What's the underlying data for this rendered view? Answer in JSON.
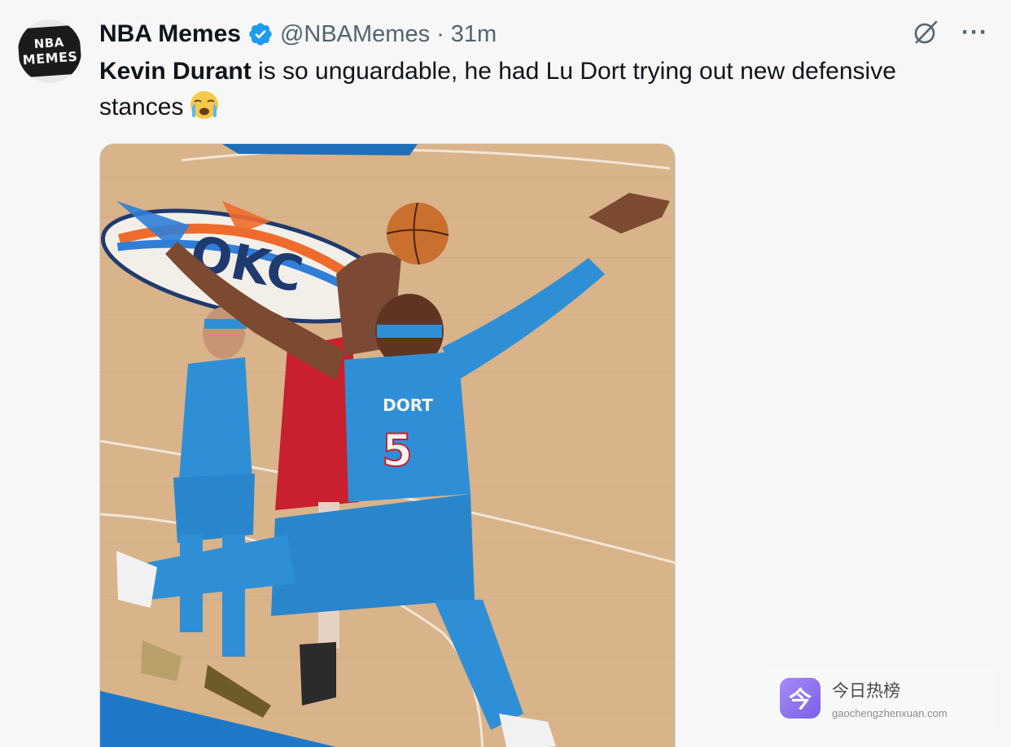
{
  "author": {
    "display_name": "NBA Memes",
    "handle": "@NBAMemes",
    "separator": "·",
    "time": "31m",
    "avatar": {
      "line1": "NBA",
      "line2": "MEMES"
    },
    "verified_color": "#1d9bf0"
  },
  "tweet": {
    "bold_name": "Kevin Durant",
    "text": " is so unguardable, he had Lu Dort trying out new defensive stances",
    "emoji": "loudly-crying-face"
  },
  "actions": {
    "grok_icon": "grok-icon",
    "more_icon": "more-icon",
    "more_glyph": "···"
  },
  "media": {
    "jersey_name": "DORT",
    "jersey_number": "5"
  },
  "watermark": {
    "title": "今日热榜",
    "url": "gaochengzhenxuan.com",
    "logo_glyph": "今",
    "logo_color": "#8f73ee"
  }
}
